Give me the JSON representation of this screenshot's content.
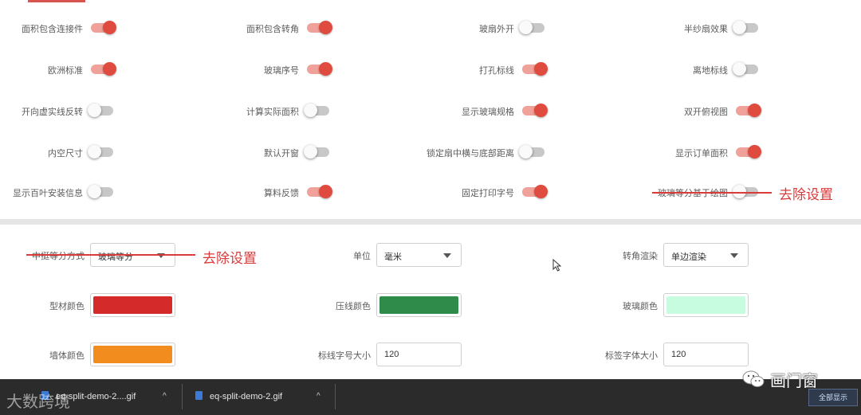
{
  "toggles": [
    [
      {
        "label": "面积包含连接件",
        "on": true
      },
      {
        "label": "面积包含转角",
        "on": true
      },
      {
        "label": "玻扇外开",
        "on": false
      },
      {
        "label": "半纱扇效果",
        "on": false
      }
    ],
    [
      {
        "label": "欧洲标准",
        "on": true
      },
      {
        "label": "玻璃序号",
        "on": true
      },
      {
        "label": "打孔标线",
        "on": true
      },
      {
        "label": "离地标线",
        "on": false
      }
    ],
    [
      {
        "label": "开向虚实线反转",
        "on": false
      },
      {
        "label": "计算实际面积",
        "on": false
      },
      {
        "label": "显示玻璃规格",
        "on": true
      },
      {
        "label": "双开俯视图",
        "on": true
      }
    ],
    [
      {
        "label": "内空尺寸",
        "on": false
      },
      {
        "label": "默认开窗",
        "on": false
      },
      {
        "label": "锁定扇中横与底部距离",
        "on": false
      },
      {
        "label": "显示订单面积",
        "on": true
      }
    ],
    [
      {
        "label": "显示百叶安装信息",
        "on": false
      },
      {
        "label": "算料反馈",
        "on": true
      },
      {
        "label": "固定打印字号",
        "on": true
      },
      {
        "label": "玻璃等分基于绘图",
        "on": false
      }
    ]
  ],
  "settings": {
    "row1": [
      {
        "label": "中挺等分方式",
        "type": "select",
        "value": "玻璃等分"
      },
      {
        "label": "单位",
        "type": "select",
        "value": "毫米"
      },
      {
        "label": "转角渲染",
        "type": "select",
        "value": "单边渲染"
      }
    ],
    "row2": [
      {
        "label": "型材颜色",
        "type": "color",
        "color": "#d42a2a"
      },
      {
        "label": "压线颜色",
        "type": "color",
        "color": "#2e8b4a"
      },
      {
        "label": "玻璃颜色",
        "type": "color",
        "color": "#c8fce0"
      }
    ],
    "row3": [
      {
        "label": "墙体颜色",
        "type": "color",
        "color": "#f28c1e"
      },
      {
        "label": "标线字号大小",
        "type": "input",
        "value": "120"
      },
      {
        "label": "标签字体大小",
        "type": "input",
        "value": "120"
      }
    ]
  },
  "annotations": {
    "remove_1": "去除设置",
    "remove_2": "去除设置"
  },
  "downloads": [
    {
      "name": "eq-split-demo-2....gif"
    },
    {
      "name": "eq-split-demo-2.gif"
    }
  ],
  "taskbar": {
    "show_all": "全部显示"
  },
  "watermarks": {
    "left": "大数跨境",
    "right": "画门窗"
  },
  "colors": {
    "accent": "#e04b3f",
    "annotation": "#d93a3a"
  }
}
